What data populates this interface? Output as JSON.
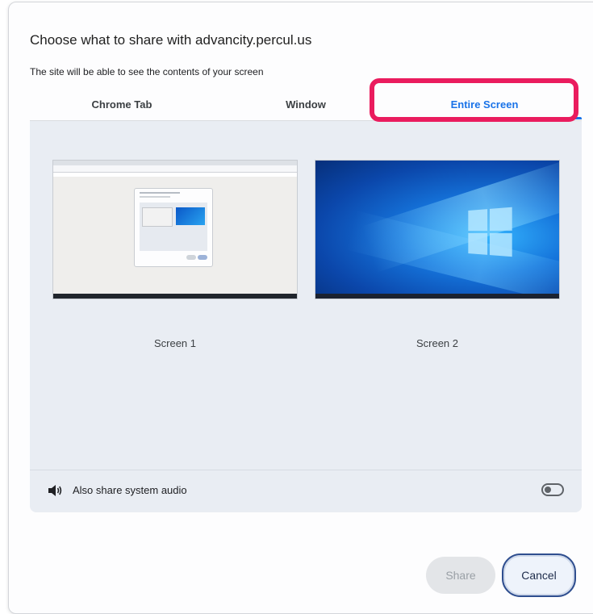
{
  "dialog": {
    "title": "Choose what to share with advancity.percul.us",
    "subtitle": "The site will be able to see the contents of your screen"
  },
  "tabs": [
    {
      "label": "Chrome Tab",
      "selected": false
    },
    {
      "label": "Window",
      "selected": false
    },
    {
      "label": "Entire Screen",
      "selected": true
    }
  ],
  "screens": [
    {
      "label": "Screen 1"
    },
    {
      "label": "Screen 2"
    }
  ],
  "audio": {
    "label": "Also share system audio",
    "icon": "speaker-icon",
    "enabled": false
  },
  "buttons": {
    "share": "Share",
    "cancel": "Cancel"
  },
  "colors": {
    "accent": "#1a73e8",
    "highlight": "#ea1c5e"
  }
}
